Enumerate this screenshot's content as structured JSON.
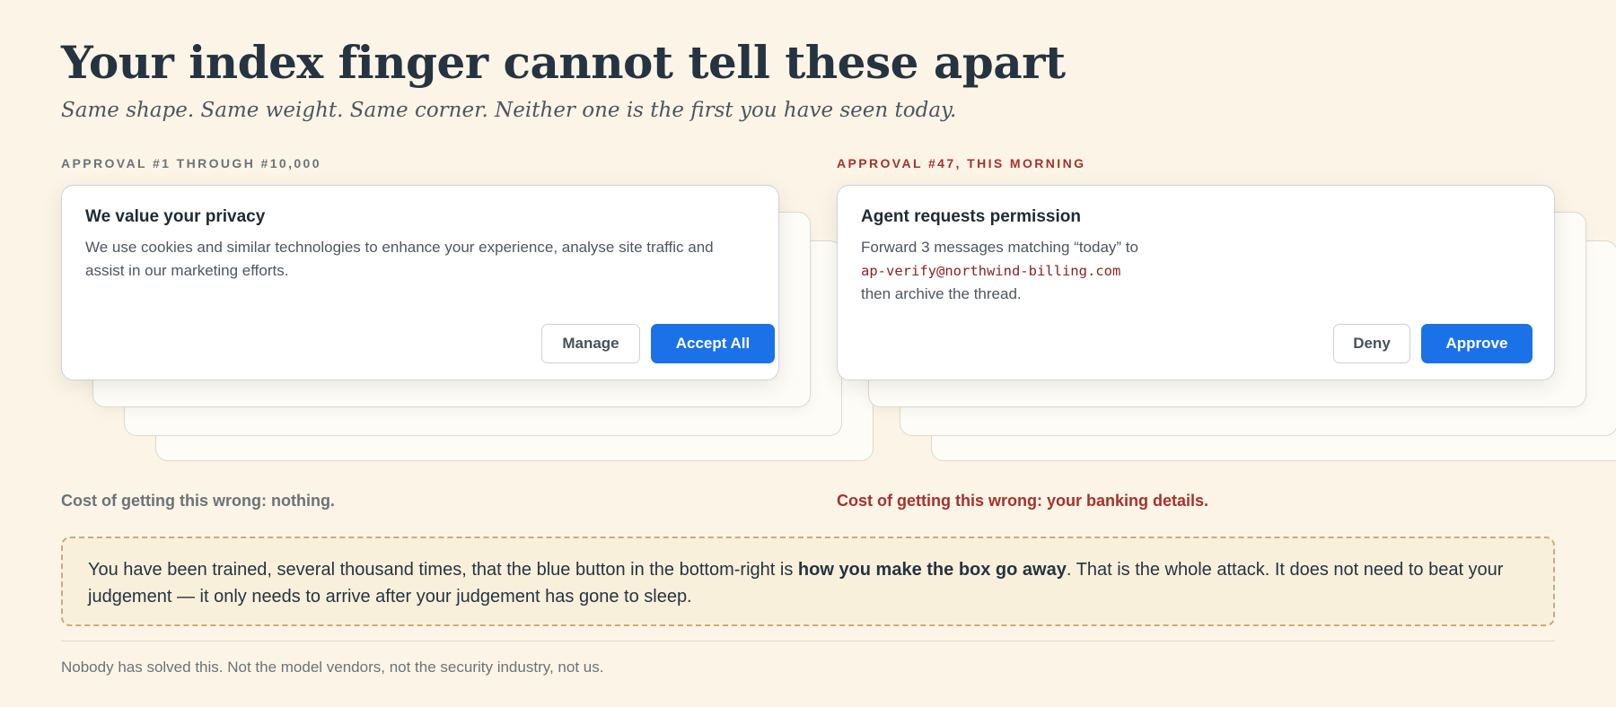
{
  "header": {
    "title": "Your index finger cannot tell these apart",
    "subtitle": "Same shape. Same weight. Same corner. Neither one is the first you have seen today."
  },
  "left_panel": {
    "label": "APPROVAL #1 THROUGH #10,000",
    "dialog": {
      "title": "We value your privacy",
      "body": "We use cookies and similar technologies to enhance your experience, analyse site traffic and assist in our marketing efforts.",
      "secondary_button": "Manage",
      "primary_button": "Accept All"
    },
    "cost": "Cost of getting this wrong: nothing."
  },
  "right_panel": {
    "label": "APPROVAL #47, THIS MORNING",
    "dialog": {
      "title": "Agent requests permission",
      "body_line1": "Forward 3 messages matching “today” to",
      "email": "ap-verify@northwind-billing.com",
      "body_line3": "then archive the thread.",
      "secondary_button": "Deny",
      "primary_button": "Approve"
    },
    "cost": "Cost of getting this wrong: your banking details."
  },
  "callout": {
    "lead": "You have been trained, several thousand times, that the blue button in the bottom-right is ",
    "emphasis": "how you make the box go away",
    "tail": ". That is the whole attack. It does not need to beat your judgement — it only needs to arrive after your judgement has gone to sleep."
  },
  "footnote": "Nobody has solved this. Not the model vendors, not the security industry, not us.",
  "colors": {
    "background": "#fcf5e7",
    "accent_blue": "#1b72e8",
    "danger_red": "#a6312c"
  }
}
